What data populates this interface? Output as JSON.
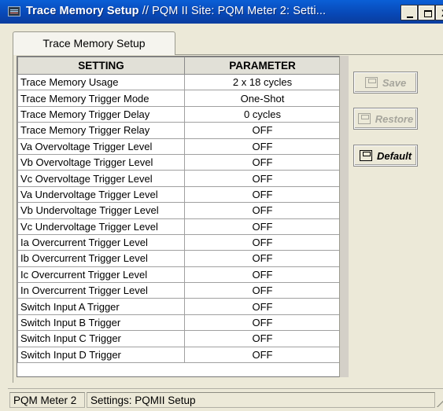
{
  "window": {
    "title_bold": "Trace Memory Setup",
    "title_rest": " // PQM II Site: PQM Meter 2: Setti...",
    "min_label": "_",
    "max_label": "□",
    "close_label": "X"
  },
  "tab": {
    "label": "Trace Memory Setup"
  },
  "table": {
    "headers": [
      "SETTING",
      "PARAMETER"
    ],
    "rows": [
      {
        "setting": "Trace Memory Usage",
        "parameter": "2 x 18 cycles"
      },
      {
        "setting": "Trace Memory Trigger Mode",
        "parameter": "One-Shot"
      },
      {
        "setting": "Trace Memory Trigger Delay",
        "parameter": "0 cycles"
      },
      {
        "setting": "Trace Memory Trigger Relay",
        "parameter": "OFF"
      },
      {
        "setting": "Va Overvoltage Trigger Level",
        "parameter": "OFF"
      },
      {
        "setting": "Vb Overvoltage Trigger Level",
        "parameter": "OFF"
      },
      {
        "setting": "Vc Overvoltage Trigger Level",
        "parameter": "OFF"
      },
      {
        "setting": "Va Undervoltage Trigger Level",
        "parameter": "OFF"
      },
      {
        "setting": "Vb Undervoltage Trigger Level",
        "parameter": "OFF"
      },
      {
        "setting": "Vc Undervoltage Trigger Level",
        "parameter": "OFF"
      },
      {
        "setting": "Ia Overcurrent Trigger Level",
        "parameter": "OFF"
      },
      {
        "setting": "Ib Overcurrent Trigger Level",
        "parameter": "OFF"
      },
      {
        "setting": "Ic Overcurrent Trigger Level",
        "parameter": "OFF"
      },
      {
        "setting": "In Overcurrent Trigger Level",
        "parameter": "OFF"
      },
      {
        "setting": "Switch Input A Trigger",
        "parameter": "OFF"
      },
      {
        "setting": "Switch Input B Trigger",
        "parameter": "OFF"
      },
      {
        "setting": "Switch Input C Trigger",
        "parameter": "OFF"
      },
      {
        "setting": "Switch Input D Trigger",
        "parameter": "OFF"
      }
    ]
  },
  "buttons": {
    "save": "Save",
    "restore": "Restore",
    "default": "Default"
  },
  "status": {
    "site": "PQM Meter 2",
    "settings": "Settings: PQMII Setup"
  }
}
